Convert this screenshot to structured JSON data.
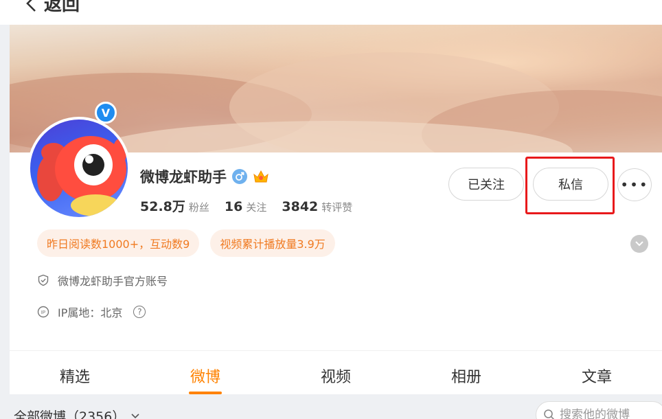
{
  "header": {
    "back_label": "返回"
  },
  "profile": {
    "name": "微博龙虾助手",
    "verified_badge": "V",
    "stats": [
      {
        "num": "52.8万",
        "label": "粉丝"
      },
      {
        "num": "16",
        "label": "关注"
      },
      {
        "num": "3842",
        "label": "转评赞"
      }
    ],
    "buttons": {
      "follow_label": "已关注",
      "message_label": "私信",
      "more_label": "•••"
    },
    "tags": [
      "昨日阅读数1000+，互动数9",
      "视频累计播放量3.9万"
    ],
    "info": {
      "certification": "微博龙虾助手官方账号",
      "ip_location": "IP属地：北京",
      "help_glyph": "?"
    }
  },
  "tabs": [
    {
      "label": "精选",
      "active": false
    },
    {
      "label": "微博",
      "active": true
    },
    {
      "label": "视频",
      "active": false
    },
    {
      "label": "相册",
      "active": false
    },
    {
      "label": "文章",
      "active": false
    }
  ],
  "feed": {
    "filter_label": "全部微博（2356）",
    "search_placeholder": "搜索他的微博"
  },
  "colors": {
    "accent": "#ff8200",
    "tag_text": "#f07a21",
    "tag_bg": "#fdf0e8",
    "highlight": "#e8191b",
    "verify": "#1f8cf0"
  }
}
